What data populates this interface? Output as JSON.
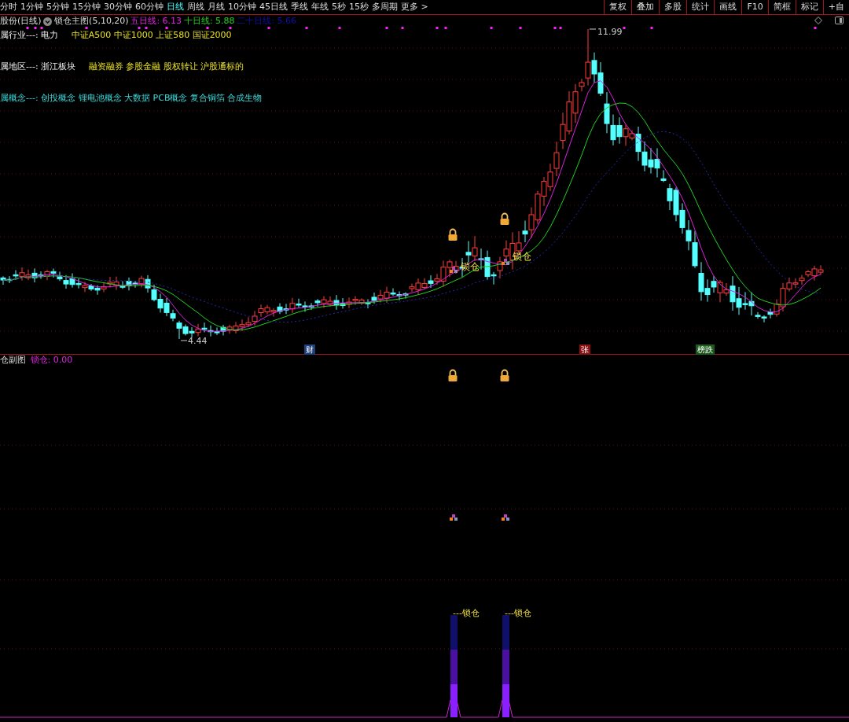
{
  "toolbar": {
    "periods": [
      {
        "label": "分时",
        "selected": false
      },
      {
        "label": "1分钟",
        "selected": false
      },
      {
        "label": "5分钟",
        "selected": false
      },
      {
        "label": "15分钟",
        "selected": false
      },
      {
        "label": "30分钟",
        "selected": false
      },
      {
        "label": "60分钟",
        "selected": false
      },
      {
        "label": "日线",
        "selected": true
      },
      {
        "label": "周线",
        "selected": false
      },
      {
        "label": "月线",
        "selected": false
      },
      {
        "label": "10分钟",
        "selected": false
      },
      {
        "label": "45日线",
        "selected": false
      },
      {
        "label": "季线",
        "selected": false
      },
      {
        "label": "年线",
        "selected": false
      },
      {
        "label": "5秒",
        "selected": false
      },
      {
        "label": "15秒",
        "selected": false
      },
      {
        "label": "多周期",
        "selected": false
      },
      {
        "label": "更多 >",
        "selected": false
      }
    ],
    "tools": [
      "复权",
      "叠加",
      "多股",
      "统计",
      "画线",
      "F10",
      "简框",
      "标记",
      "+自"
    ]
  },
  "main_chart": {
    "stock": "股份(日线)",
    "indicator": "锁仓主图(5,10,20)",
    "ma_legend": [
      {
        "label": "五日线: 6.13",
        "color": "#e020e0"
      },
      {
        "label": "十日线: 5.88",
        "color": "#20d020"
      },
      {
        "label": "二十日线: 5.66",
        "color": "#1010a0"
      }
    ],
    "info_lines": [
      {
        "kind": "plain",
        "label": "属行业---: 电力",
        "tags": "中证A500 中证1000 上证580 国证2000"
      },
      {
        "kind": "plain",
        "label": "属地区---: 浙江板块",
        "tags": "融资融券 参股金融 股权转让 沪股通标的"
      },
      {
        "kind": "concept",
        "label": "属概念---: 创投概念 锂电池概念 大数据 PCB概念 复合铜箔 合成生物"
      }
    ],
    "high_label": "11.99",
    "low_label": "4.44",
    "signals": [
      "锁仓",
      "锁仓"
    ],
    "event_tags": [
      {
        "label": "财",
        "color": "#1f3f7a"
      },
      {
        "label": "张",
        "color": "#8a1212"
      },
      {
        "label": "榜跌",
        "color": "#1d5a1d"
      }
    ]
  },
  "sub_chart": {
    "title": "仓副图",
    "value": "锁仓: 0.00",
    "bar_labels": [
      "---锁仓",
      "---锁仓"
    ]
  }
}
